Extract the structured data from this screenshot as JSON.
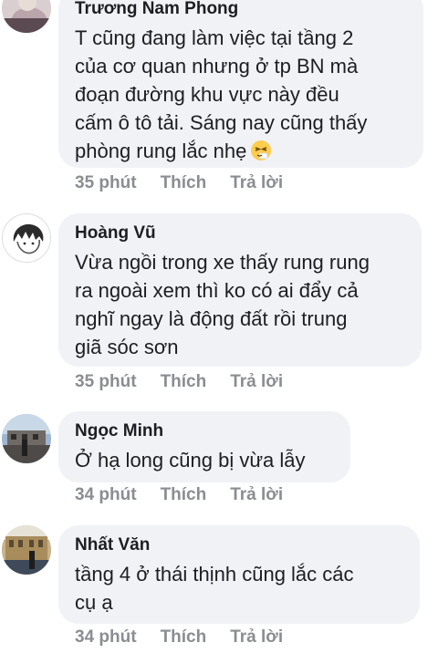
{
  "comments": [
    {
      "author": "Trương Nam Phong",
      "text": "T cũng đang làm việc tại tầng 2\ncủa cơ quan nhưng ở tp BN mà\nđoạn đường khu vực này đều\ncấm ô tô tải. Sáng nay cũng thấy\nphòng rung lắc nhẹ",
      "emoji": "sneezing-face-emoji",
      "time": "35 phút",
      "like": "Thích",
      "reply": "Trả lời"
    },
    {
      "author": "Hoàng Vũ",
      "text": "Vừa ngồi trong xe thấy rung rung\nra ngoài xem thì ko có ai đẩy cả\nnghĩ ngay là động đất rồi trung\ngiã sóc sơn",
      "time": "35 phút",
      "like": "Thích",
      "reply": "Trả lời"
    },
    {
      "author": "Ngọc Minh",
      "text": "Ở hạ long cũng bị vừa lẫy",
      "time": "34 phút",
      "like": "Thích",
      "reply": "Trả lời"
    },
    {
      "author": "Nhất Văn",
      "text": "tầng 4 ở thái thịnh cũng lắc các\ncụ ạ",
      "time": "34 phút",
      "like": "Thích",
      "reply": "Trả lời"
    }
  ],
  "colors": {
    "bubble": "#f0f2f5",
    "text": "#1c1e21",
    "meta": "#8a8d91"
  }
}
